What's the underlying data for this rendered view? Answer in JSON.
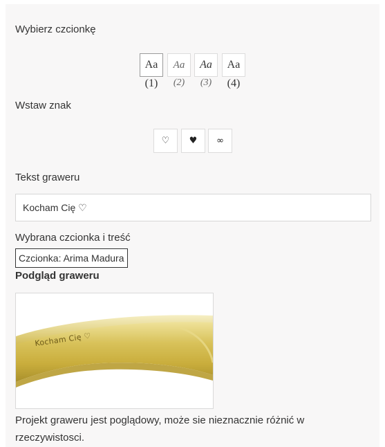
{
  "sections": {
    "font_label": "Wybierz czcionkę",
    "symbol_label": "Wstaw znak",
    "text_label": "Tekst graweru",
    "summary_label": "Wybrana czcionka i treść",
    "preview_label": "Podgląd graweru"
  },
  "fonts": [
    {
      "sample": "Aa",
      "number": "(1)",
      "selected": true
    },
    {
      "sample": "Aa",
      "number": "(2)",
      "selected": false
    },
    {
      "sample": "Aa",
      "number": "(3)",
      "selected": false
    },
    {
      "sample": "Aa",
      "number": "(4)",
      "selected": false
    }
  ],
  "symbols": [
    "♡",
    "♥",
    "∞"
  ],
  "engraving": {
    "text_value": "Kocham Cię ♡",
    "summary_value": "Czcionka: Arima Madurai",
    "preview_text": "Kocham Cię ♡"
  },
  "note": "Projekt graweru jest poglądowy, może sie nieznacznie różnić w rzeczywistosci.",
  "colors": {
    "panel_bg": "#f8f7f7",
    "ring_gold": "#d9c35a",
    "engrave": "#6d5a18"
  }
}
